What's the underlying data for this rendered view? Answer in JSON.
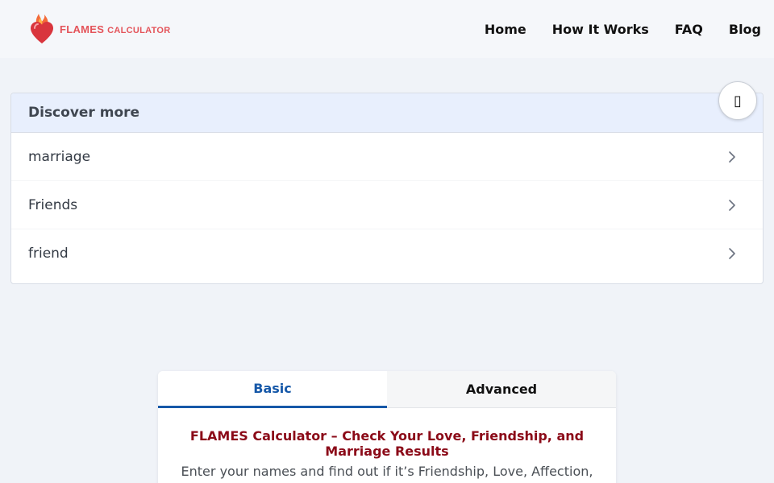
{
  "header": {
    "logo_text_flames": "FLAMES ",
    "logo_text_calc": "CALCULATOR",
    "nav": [
      {
        "label": "Home"
      },
      {
        "label": "How It Works"
      },
      {
        "label": "FAQ"
      },
      {
        "label": "Blog"
      }
    ]
  },
  "discover": {
    "title": "Discover more",
    "items": [
      {
        "label": "marriage"
      },
      {
        "label": "Friends"
      },
      {
        "label": "friend"
      }
    ]
  },
  "fab": {
    "glyph": "▯"
  },
  "calculator": {
    "tabs": [
      {
        "label": "Basic",
        "active": true
      },
      {
        "label": "Advanced",
        "active": false
      }
    ],
    "title": "FLAMES Calculator – Check Your Love, Friendship, and Marriage Results",
    "description": "Enter your names and find out if it’s Friendship, Love, Affection,"
  },
  "colors": {
    "accent": "#1658a8",
    "title_red": "#8b0a18",
    "logo_red": "#e4545a",
    "discover_header": "#e8effd",
    "page_bg": "#f0f3f8"
  },
  "icons": [
    "flaming-heart-logo-icon",
    "chevron-right-icon"
  ]
}
